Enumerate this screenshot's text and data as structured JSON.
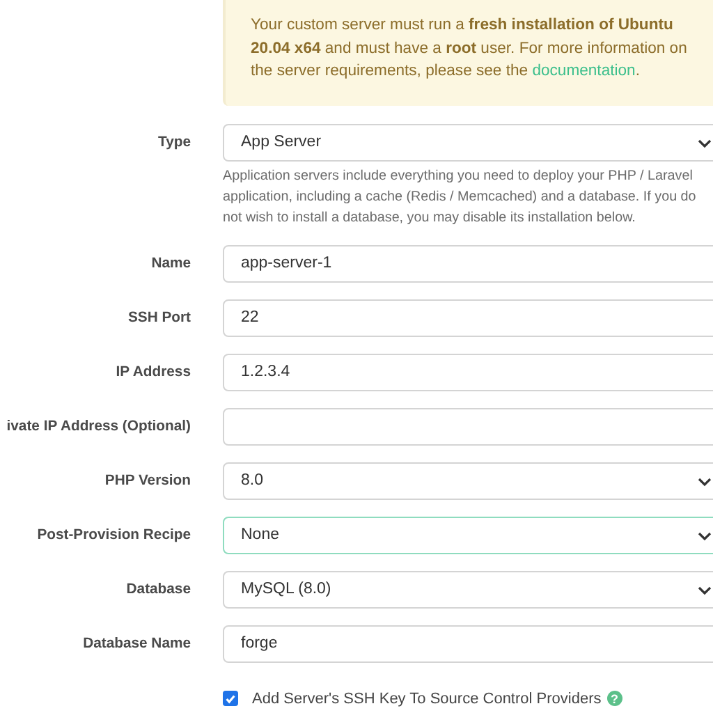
{
  "notice": {
    "text": "Your custom server must run a **fresh installation of Ubuntu 20.04 x64** and must have a **root** user. For more information on the server requirements, please see the ",
    "link": "documentation",
    "after": "."
  },
  "fields": [
    {
      "label": "Type",
      "kind": "select",
      "value": "App Server",
      "focused": false,
      "help": "Application servers include everything you need to deploy your PHP / Laravel application, including a cache (Redis / Memcached) and a database. If you do not wish to install a database, you may disable its installation below."
    },
    {
      "label": "Name",
      "kind": "text",
      "value": "app-server-1",
      "focused": false
    },
    {
      "label": "SSH Port",
      "kind": "text",
      "value": "22",
      "focused": false
    },
    {
      "label": "IP Address",
      "kind": "text",
      "value": "1.2.3.4",
      "focused": false
    },
    {
      "label": "ivate IP Address (Optional)",
      "kind": "text",
      "focused": false
    },
    {
      "label": "PHP Version",
      "kind": "select",
      "value": "8.0",
      "focused": false
    },
    {
      "label": "Post-Provision Recipe",
      "kind": "select",
      "value": "None",
      "focused": true
    },
    {
      "label": "Database",
      "kind": "select",
      "value": "MySQL (8.0)",
      "focused": false
    },
    {
      "label": "Database Name",
      "kind": "text",
      "value": "forge",
      "focused": false
    }
  ],
  "checkbox": {
    "label": "Add Server's SSH Key To Source Control Providers",
    "checked": true,
    "help_icon": "?"
  }
}
